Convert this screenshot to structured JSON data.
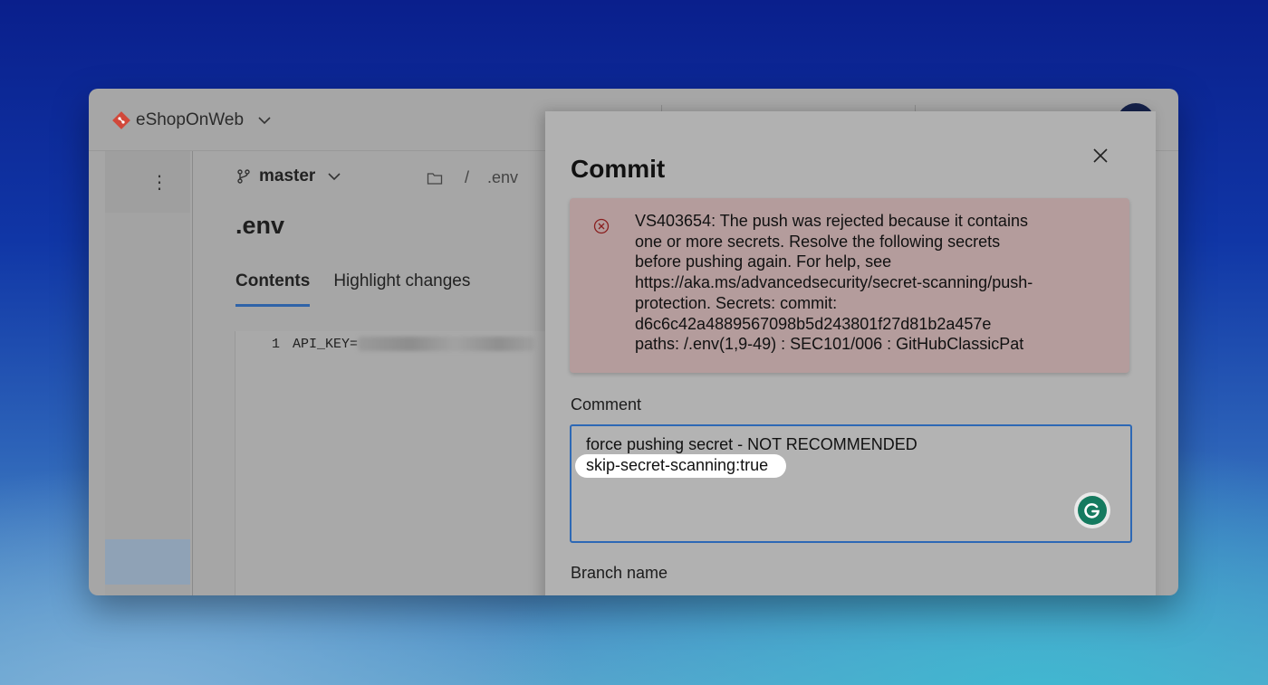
{
  "repo": {
    "name": "eShopOnWeb"
  },
  "colors": {
    "accent": "#2d68b5",
    "error_bg": "#b49c9c",
    "logo": "#d1483a",
    "grammarly": "#157a5f"
  },
  "branch": {
    "name": "master"
  },
  "breadcrumb": {
    "separator": "/",
    "file": ".env"
  },
  "file": {
    "title": ".env"
  },
  "tabs": [
    {
      "label": "Contents",
      "active": true
    },
    {
      "label": "Highlight changes",
      "active": false
    }
  ],
  "code": {
    "line_number": "1",
    "text": "API_KEY="
  },
  "commit": {
    "title": "Commit",
    "error": "VS403654: The push was rejected because it contains\none or more secrets. Resolve the following secrets\nbefore pushing again. For help, see\nhttps://aka.ms/advancedsecurity/secret-scanning/push-\nprotection. Secrets: commit:\nd6c6c42a4889567098b5d243801f27d81b2a457e\npaths: /.env(1,9-49) : SEC101/006 : GitHubClassicPat",
    "comment_label": "Comment",
    "comment_line1": "force pushing secret - NOT RECOMMENDED",
    "comment_line2": "skip-secret-scanning:true",
    "branch_label": "Branch name"
  },
  "icons": {
    "more": "more-vertical-icon",
    "close": "close-icon",
    "error": "error-circle-icon",
    "grammarly": "grammarly-icon"
  }
}
